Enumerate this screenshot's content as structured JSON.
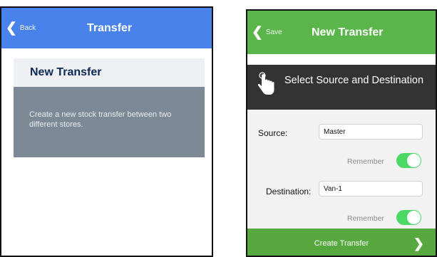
{
  "left_screen": {
    "nav": {
      "back_label": "Back",
      "title": "Transfer"
    },
    "card": {
      "title": "New Transfer",
      "description": "Create a new stock transfer between two different stores."
    }
  },
  "right_screen": {
    "nav": {
      "back_label": "Save",
      "title": "New Transfer"
    },
    "modal": {
      "title": "Select Source and Destination",
      "source_label": "Source:",
      "source_value": "Master",
      "destination_label": "Destination:",
      "destination_value": "Van-1",
      "remember_label": "Remember",
      "source_remember_on": true,
      "destination_remember_on": true,
      "create_button_label": "Create Transfer"
    }
  },
  "colors": {
    "left_nav": "#4a82ec",
    "right_nav": "#5ab54b",
    "toggle_on": "#4cd964",
    "footer": "#56a83f",
    "card_body": "#7d8a96"
  },
  "icons": {
    "back": "chevron-left-icon",
    "modal": "hand-pointer-icon",
    "footer": "chevron-right-icon"
  }
}
